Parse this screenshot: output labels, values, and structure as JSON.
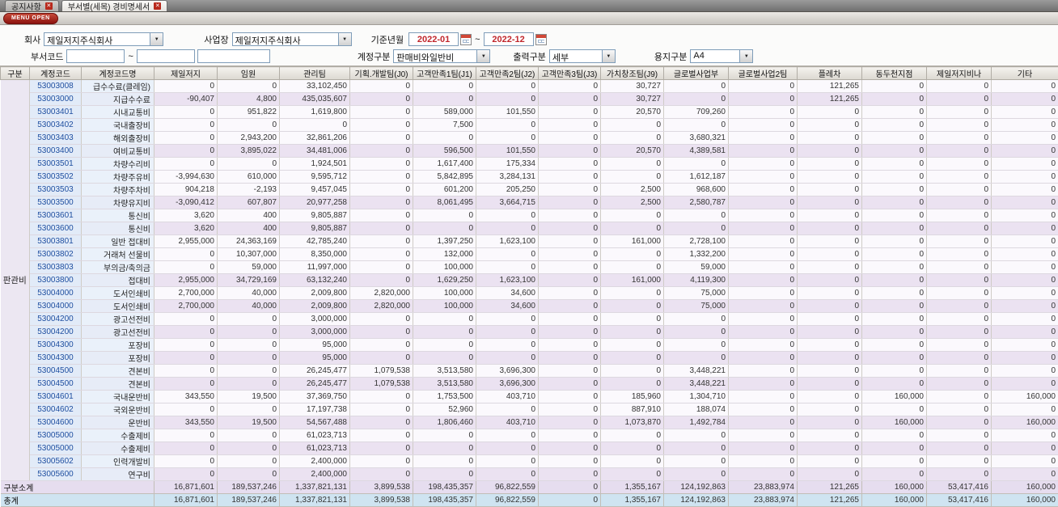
{
  "tabs": [
    {
      "label": "공지사항"
    },
    {
      "label": "부서별(세목) 경비명세서"
    }
  ],
  "menu_open_label": "MENU OPEN",
  "filters": {
    "company_label": "회사",
    "company_value": "제일저지주식회사",
    "site_label": "사업장",
    "site_value": "제일저지주식회사",
    "period_label": "기준년월",
    "period_from": "2022-01",
    "period_to": "2022-12",
    "tilde": "~",
    "dept_code_label": "부서코드",
    "account_label": "계정구분",
    "account_value": "판매비와일반비",
    "output_label": "출력구분",
    "output_value": "세부",
    "paper_label": "용지구분",
    "paper_value": "A4"
  },
  "table": {
    "columns": [
      "구분",
      "계정코드",
      "계정코드명",
      "제일저지",
      "임원",
      "관리팀",
      "기획.개발팀(J0)",
      "고객만족1팀(J1)",
      "고객만족2팀(J2)",
      "고객만족3팀(J3)",
      "가치창조팀(J9)",
      "글로벌사업부",
      "글로벌사업2팀",
      "플레차",
      "동두천지점",
      "제일저지비나",
      "기타"
    ],
    "group_label": "판관비",
    "rows": [
      {
        "t": "d",
        "code": "53003008",
        "name": "급수수료(클레임)",
        "values": [
          "0",
          "0",
          "33,102,450",
          "0",
          "0",
          "0",
          "0",
          "30,727",
          "0",
          "0",
          "121,265",
          "0",
          "0",
          "0"
        ]
      },
      {
        "t": "s",
        "code": "53003000",
        "name": "지급수수료",
        "values": [
          "-90,407",
          "4,800",
          "435,035,607",
          "0",
          "0",
          "0",
          "0",
          "30,727",
          "0",
          "0",
          "121,265",
          "0",
          "0",
          "0"
        ]
      },
      {
        "t": "d",
        "code": "53003401",
        "name": "시내교통비",
        "values": [
          "0",
          "951,822",
          "1,619,800",
          "0",
          "589,000",
          "101,550",
          "0",
          "20,570",
          "709,260",
          "0",
          "0",
          "0",
          "0",
          "0"
        ]
      },
      {
        "t": "d",
        "code": "53003402",
        "name": "국내출장비",
        "values": [
          "0",
          "0",
          "0",
          "0",
          "7,500",
          "0",
          "0",
          "0",
          "0",
          "0",
          "0",
          "0",
          "0",
          "0"
        ]
      },
      {
        "t": "d",
        "code": "53003403",
        "name": "해외출장비",
        "values": [
          "0",
          "2,943,200",
          "32,861,206",
          "0",
          "0",
          "0",
          "0",
          "0",
          "3,680,321",
          "0",
          "0",
          "0",
          "0",
          "0"
        ]
      },
      {
        "t": "s",
        "code": "53003400",
        "name": "여비교통비",
        "values": [
          "0",
          "3,895,022",
          "34,481,006",
          "0",
          "596,500",
          "101,550",
          "0",
          "20,570",
          "4,389,581",
          "0",
          "0",
          "0",
          "0",
          "0"
        ]
      },
      {
        "t": "d",
        "code": "53003501",
        "name": "차량수리비",
        "values": [
          "0",
          "0",
          "1,924,501",
          "0",
          "1,617,400",
          "175,334",
          "0",
          "0",
          "0",
          "0",
          "0",
          "0",
          "0",
          "0"
        ]
      },
      {
        "t": "d",
        "code": "53003502",
        "name": "차량주유비",
        "values": [
          "-3,994,630",
          "610,000",
          "9,595,712",
          "0",
          "5,842,895",
          "3,284,131",
          "0",
          "0",
          "1,612,187",
          "0",
          "0",
          "0",
          "0",
          "0"
        ]
      },
      {
        "t": "d",
        "code": "53003503",
        "name": "차량주차비",
        "values": [
          "904,218",
          "-2,193",
          "9,457,045",
          "0",
          "601,200",
          "205,250",
          "0",
          "2,500",
          "968,600",
          "0",
          "0",
          "0",
          "0",
          "0"
        ]
      },
      {
        "t": "s",
        "code": "53003500",
        "name": "차량유지비",
        "values": [
          "-3,090,412",
          "607,807",
          "20,977,258",
          "0",
          "8,061,495",
          "3,664,715",
          "0",
          "2,500",
          "2,580,787",
          "0",
          "0",
          "0",
          "0",
          "0"
        ]
      },
      {
        "t": "d",
        "code": "53003601",
        "name": "통신비",
        "values": [
          "3,620",
          "400",
          "9,805,887",
          "0",
          "0",
          "0",
          "0",
          "0",
          "0",
          "0",
          "0",
          "0",
          "0",
          "0"
        ]
      },
      {
        "t": "s",
        "code": "53003600",
        "name": "통신비",
        "values": [
          "3,620",
          "400",
          "9,805,887",
          "0",
          "0",
          "0",
          "0",
          "0",
          "0",
          "0",
          "0",
          "0",
          "0",
          "0"
        ]
      },
      {
        "t": "d",
        "code": "53003801",
        "name": "일반 접대비",
        "values": [
          "2,955,000",
          "24,363,169",
          "42,785,240",
          "0",
          "1,397,250",
          "1,623,100",
          "0",
          "161,000",
          "2,728,100",
          "0",
          "0",
          "0",
          "0",
          "0"
        ]
      },
      {
        "t": "d",
        "code": "53003802",
        "name": "거래처 선물비",
        "values": [
          "0",
          "10,307,000",
          "8,350,000",
          "0",
          "132,000",
          "0",
          "0",
          "0",
          "1,332,200",
          "0",
          "0",
          "0",
          "0",
          "0"
        ]
      },
      {
        "t": "d",
        "code": "53003803",
        "name": "부의금/축의금",
        "values": [
          "0",
          "59,000",
          "11,997,000",
          "0",
          "100,000",
          "0",
          "0",
          "0",
          "59,000",
          "0",
          "0",
          "0",
          "0",
          "0"
        ]
      },
      {
        "t": "s",
        "code": "53003800",
        "name": "접대비",
        "values": [
          "2,955,000",
          "34,729,169",
          "63,132,240",
          "0",
          "1,629,250",
          "1,623,100",
          "0",
          "161,000",
          "4,119,300",
          "0",
          "0",
          "0",
          "0",
          "0"
        ]
      },
      {
        "t": "d",
        "code": "53004000",
        "name": "도서인쇄비",
        "values": [
          "2,700,000",
          "40,000",
          "2,009,800",
          "2,820,000",
          "100,000",
          "34,600",
          "0",
          "0",
          "75,000",
          "0",
          "0",
          "0",
          "0",
          "0"
        ]
      },
      {
        "t": "s",
        "code": "53004000",
        "name": "도서인쇄비",
        "values": [
          "2,700,000",
          "40,000",
          "2,009,800",
          "2,820,000",
          "100,000",
          "34,600",
          "0",
          "0",
          "75,000",
          "0",
          "0",
          "0",
          "0",
          "0"
        ]
      },
      {
        "t": "d",
        "code": "53004200",
        "name": "광고선전비",
        "values": [
          "0",
          "0",
          "3,000,000",
          "0",
          "0",
          "0",
          "0",
          "0",
          "0",
          "0",
          "0",
          "0",
          "0",
          "0"
        ]
      },
      {
        "t": "s",
        "code": "53004200",
        "name": "광고선전비",
        "values": [
          "0",
          "0",
          "3,000,000",
          "0",
          "0",
          "0",
          "0",
          "0",
          "0",
          "0",
          "0",
          "0",
          "0",
          "0"
        ]
      },
      {
        "t": "d",
        "code": "53004300",
        "name": "포장비",
        "values": [
          "0",
          "0",
          "95,000",
          "0",
          "0",
          "0",
          "0",
          "0",
          "0",
          "0",
          "0",
          "0",
          "0",
          "0"
        ]
      },
      {
        "t": "s",
        "code": "53004300",
        "name": "포장비",
        "values": [
          "0",
          "0",
          "95,000",
          "0",
          "0",
          "0",
          "0",
          "0",
          "0",
          "0",
          "0",
          "0",
          "0",
          "0"
        ]
      },
      {
        "t": "d",
        "code": "53004500",
        "name": "견본비",
        "values": [
          "0",
          "0",
          "26,245,477",
          "1,079,538",
          "3,513,580",
          "3,696,300",
          "0",
          "0",
          "3,448,221",
          "0",
          "0",
          "0",
          "0",
          "0"
        ]
      },
      {
        "t": "s",
        "code": "53004500",
        "name": "견본비",
        "values": [
          "0",
          "0",
          "26,245,477",
          "1,079,538",
          "3,513,580",
          "3,696,300",
          "0",
          "0",
          "3,448,221",
          "0",
          "0",
          "0",
          "0",
          "0"
        ]
      },
      {
        "t": "d",
        "code": "53004601",
        "name": "국내운반비",
        "values": [
          "343,550",
          "19,500",
          "37,369,750",
          "0",
          "1,753,500",
          "403,710",
          "0",
          "185,960",
          "1,304,710",
          "0",
          "0",
          "160,000",
          "0",
          "160,000"
        ]
      },
      {
        "t": "d",
        "code": "53004602",
        "name": "국외운반비",
        "values": [
          "0",
          "0",
          "17,197,738",
          "0",
          "52,960",
          "0",
          "0",
          "887,910",
          "188,074",
          "0",
          "0",
          "0",
          "0",
          "0"
        ]
      },
      {
        "t": "s",
        "code": "53004600",
        "name": "운반비",
        "values": [
          "343,550",
          "19,500",
          "54,567,488",
          "0",
          "1,806,460",
          "403,710",
          "0",
          "1,073,870",
          "1,492,784",
          "0",
          "0",
          "160,000",
          "0",
          "160,000"
        ]
      },
      {
        "t": "d",
        "code": "53005000",
        "name": "수출제비",
        "values": [
          "0",
          "0",
          "61,023,713",
          "0",
          "0",
          "0",
          "0",
          "0",
          "0",
          "0",
          "0",
          "0",
          "0",
          "0"
        ]
      },
      {
        "t": "s",
        "code": "53005000",
        "name": "수출제비",
        "values": [
          "0",
          "0",
          "61,023,713",
          "0",
          "0",
          "0",
          "0",
          "0",
          "0",
          "0",
          "0",
          "0",
          "0",
          "0"
        ]
      },
      {
        "t": "d",
        "code": "53005602",
        "name": "인력개발비",
        "values": [
          "0",
          "0",
          "2,400,000",
          "0",
          "0",
          "0",
          "0",
          "0",
          "0",
          "0",
          "0",
          "0",
          "0",
          "0"
        ]
      },
      {
        "t": "s",
        "code": "53005600",
        "name": "연구비",
        "values": [
          "0",
          "0",
          "2,400,000",
          "0",
          "0",
          "0",
          "0",
          "0",
          "0",
          "0",
          "0",
          "0",
          "0",
          "0"
        ]
      }
    ],
    "footer": [
      {
        "label": "구분소계",
        "values": [
          "16,871,601",
          "189,537,246",
          "1,337,821,131",
          "3,899,538",
          "198,435,357",
          "96,822,559",
          "0",
          "1,355,167",
          "124,192,863",
          "23,883,974",
          "121,265",
          "160,000",
          "53,417,416",
          "160,000"
        ]
      },
      {
        "label": "총계",
        "values": [
          "16,871,601",
          "189,537,246",
          "1,337,821,131",
          "3,899,538",
          "198,435,357",
          "96,822,559",
          "0",
          "1,355,167",
          "124,192,863",
          "23,883,974",
          "121,265",
          "160,000",
          "53,417,416",
          "160,000"
        ]
      }
    ]
  }
}
